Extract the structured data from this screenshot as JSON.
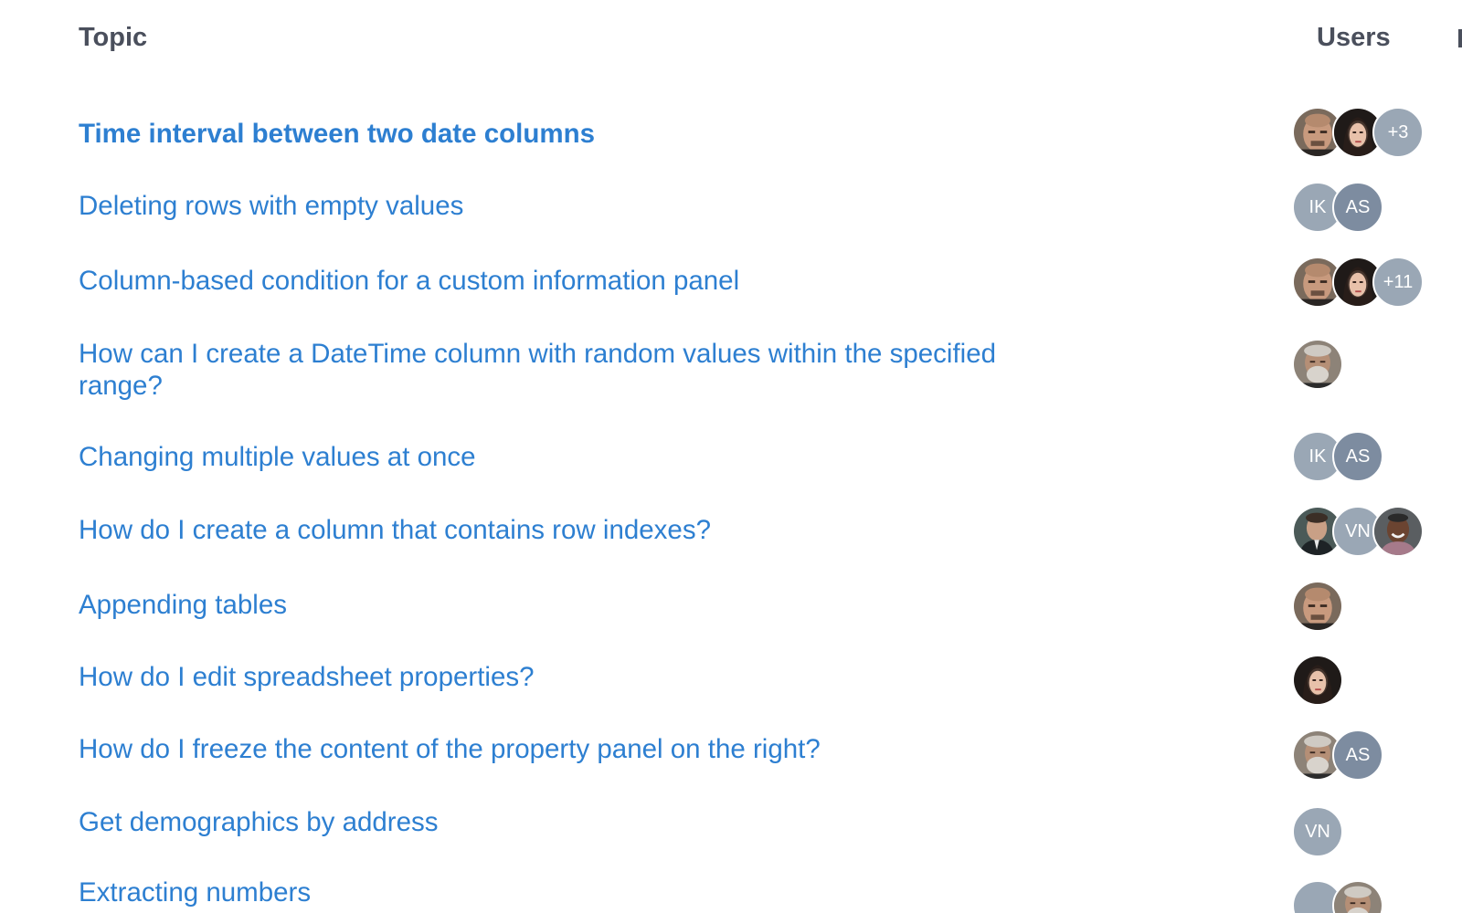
{
  "header": {
    "topic_label": "Topic",
    "users_label": "Users"
  },
  "rows": [
    {
      "title": "Time interval between two date columns",
      "users": [
        {
          "kind": "photo",
          "name": "bald-man-photo"
        },
        {
          "kind": "photo",
          "name": "dark-hair-woman-photo"
        },
        {
          "kind": "more",
          "text": "+3"
        }
      ]
    },
    {
      "title": "Deleting rows with empty values",
      "users": [
        {
          "kind": "initials",
          "text": "IK"
        },
        {
          "kind": "initials",
          "text": "AS"
        }
      ]
    },
    {
      "title": "Column-based condition for a custom information panel",
      "users": [
        {
          "kind": "photo",
          "name": "bald-man-photo"
        },
        {
          "kind": "photo",
          "name": "dark-hair-woman-photo"
        },
        {
          "kind": "more",
          "text": "+11"
        }
      ]
    },
    {
      "title": "How can I create a DateTime column with random values within the specified range?",
      "users": [
        {
          "kind": "photo",
          "name": "gray-beard-man-photo"
        }
      ]
    },
    {
      "title": "Changing multiple values at once",
      "users": [
        {
          "kind": "initials",
          "text": "IK"
        },
        {
          "kind": "initials",
          "text": "AS"
        }
      ]
    },
    {
      "title": "How do I create a column that contains row indexes?",
      "users": [
        {
          "kind": "photo",
          "name": "suit-man-photo"
        },
        {
          "kind": "initials",
          "text": "VN"
        },
        {
          "kind": "photo",
          "name": "smiling-man-photo"
        }
      ]
    },
    {
      "title": "Appending tables",
      "users": [
        {
          "kind": "photo",
          "name": "bald-man-photo"
        }
      ]
    },
    {
      "title": "How do I edit spreadsheet properties?",
      "users": [
        {
          "kind": "photo",
          "name": "dark-hair-woman-photo"
        }
      ]
    },
    {
      "title": "How do I freeze the content of the property panel on the right?",
      "users": [
        {
          "kind": "photo",
          "name": "gray-beard-man-photo"
        },
        {
          "kind": "initials",
          "text": "AS"
        }
      ]
    },
    {
      "title": "Get demographics by address",
      "users": [
        {
          "kind": "initials",
          "text": "VN"
        }
      ]
    },
    {
      "title": "Extracting numbers",
      "users": [
        {
          "kind": "initials",
          "text": ""
        },
        {
          "kind": "photo",
          "name": "gray-beard-man-photo"
        }
      ]
    }
  ],
  "colors": {
    "link": "#2d7fd1",
    "header_text": "#4a4f5c",
    "avatar_initials_bg": "#9aa7b5"
  }
}
